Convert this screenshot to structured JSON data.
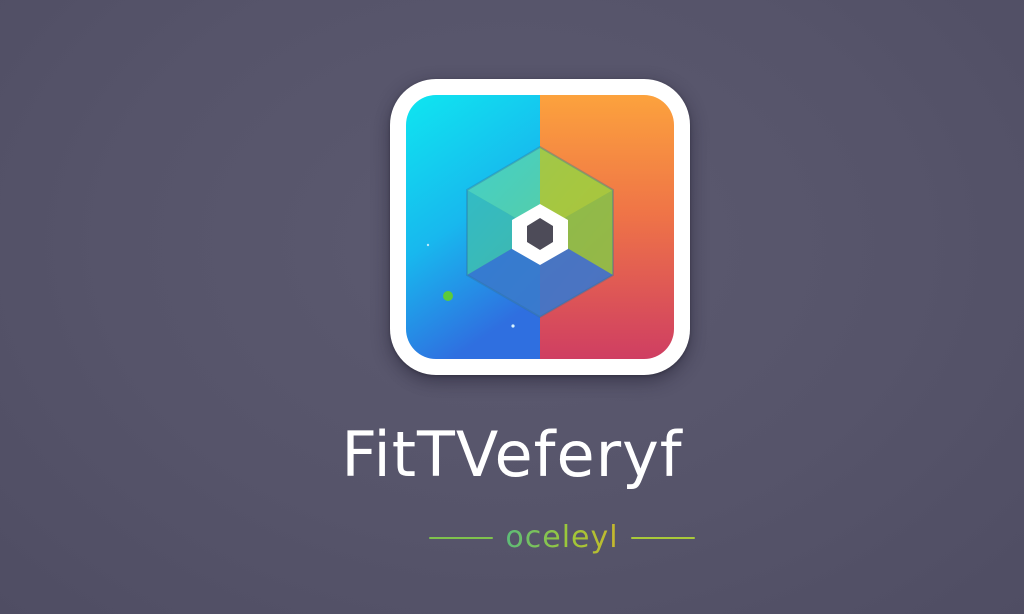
{
  "logo": {
    "icon_name": "hexagon-app-icon",
    "brand_name": "FitTVeferyf",
    "tagline": "oceleyl",
    "colors": {
      "background": "#56546a",
      "cyan": "#0ee3ee",
      "blue": "#2a7fe6",
      "orange": "#f99d3a",
      "red": "#d8445e",
      "frame": "#ffffff",
      "tagline_green": "#7fc24d",
      "tagline_gold": "#c8b72c"
    }
  }
}
